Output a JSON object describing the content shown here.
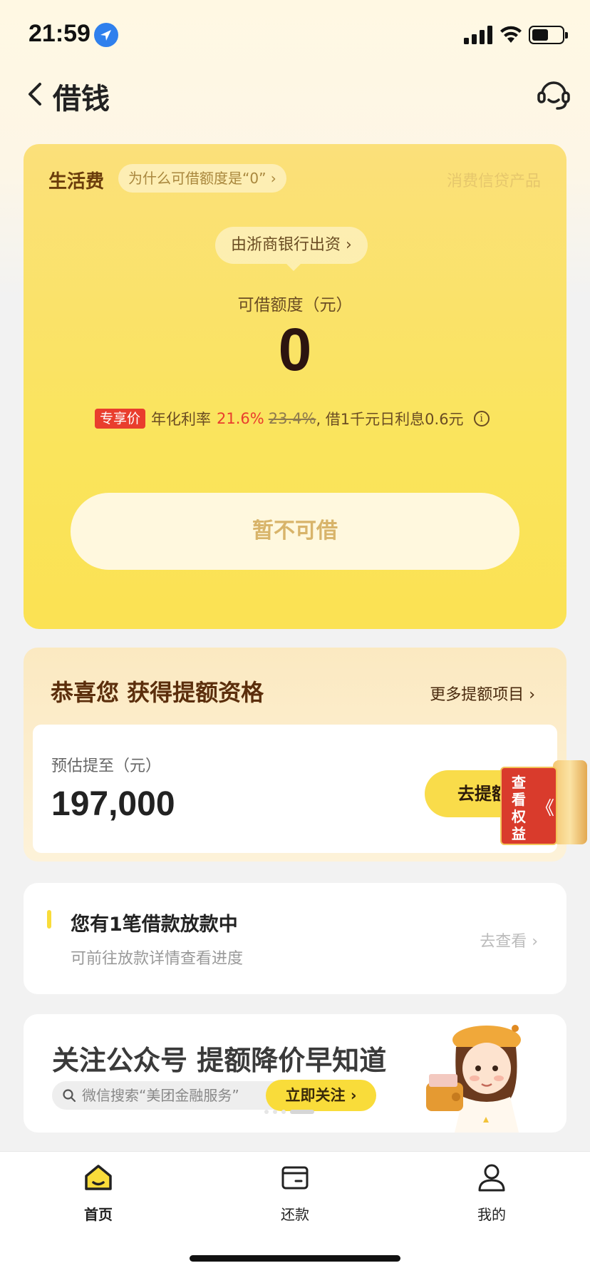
{
  "status_bar": {
    "time": "21:59"
  },
  "nav": {
    "title": "借钱"
  },
  "loan_card": {
    "label": "生活费",
    "why_zero": "为什么可借额度是“0” ›",
    "product_type": "消费信贷产品",
    "funder": "由浙商银行出资 ›",
    "quota_label": "可借额度（元）",
    "quota_value": "0",
    "tag": "专享价",
    "rate_label": "年化利率",
    "rate_new": "21.6%",
    "rate_old": "23.4%",
    "interest_info": ", 借1千元日利息0.6元",
    "borrow_button": "暂不可借"
  },
  "upgrade_card": {
    "title": "恭喜您 获得提额资格",
    "more_link": "更多提额项目 ›",
    "estimate_label": "预估提至（元）",
    "estimate_value": "197,000",
    "go_button": "去提额",
    "benefit_badge": "查看权益",
    "benefit_arrow": "《"
  },
  "loan_progress": {
    "title": "您有1笔借款放款中",
    "subtitle": "可前往放款详情查看进度",
    "link": "去查看 ›"
  },
  "banner": {
    "headline": "关注公众号 提额降价早知道",
    "search_text": "微信搜索“美团金融服务”",
    "follow_button": "立即关注 ›"
  },
  "tabbar": {
    "items": [
      {
        "label": "首页",
        "icon": "home-icon",
        "active": true
      },
      {
        "label": "还款",
        "icon": "wallet-icon",
        "active": false
      },
      {
        "label": "我的",
        "icon": "person-icon",
        "active": false
      }
    ]
  },
  "colors": {
    "accent_yellow": "#F9DC3A",
    "rate_red": "#E93D2D",
    "brown_text": "#6B3D0C"
  }
}
